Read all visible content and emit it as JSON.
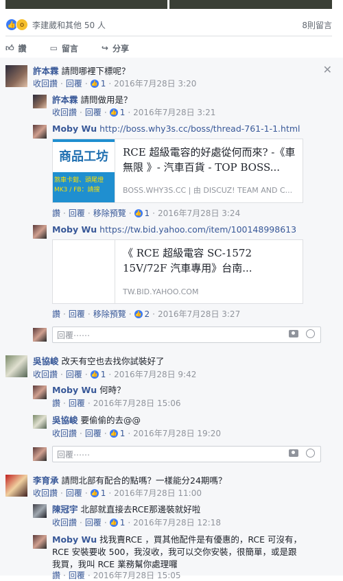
{
  "post": {
    "reactions_text": "李建葳和其他 50 人",
    "comment_count": "8則留言",
    "actions": {
      "like": "讚",
      "comment": "留言",
      "share": "分享"
    }
  },
  "actions": {
    "unlike": "收回讚",
    "like": "讚",
    "reply": "回覆",
    "remove_preview": "移除預覽",
    "reply_placeholder": "回覆⋯⋯"
  },
  "comments": [
    {
      "author": "許本霖",
      "text": "請問哪裡下標呢？",
      "likes": "1",
      "time": "2016年7月28日 3:20",
      "replies": [
        {
          "author": "許本霖",
          "text": "請問做用是？",
          "likes": "1",
          "time": "2016年7月28日 3:21"
        },
        {
          "author": "Moby Wu",
          "link": "http://boss.why3s.cc/boss/thread-761-1-1.html",
          "preview": {
            "title": "RCE 超級電容的好處從何而來? -《車無限 》- 汽車百貨 - TOP BOSS...",
            "domain": "BOSS.WHY3S.CC | 由 DISCUZ! TEAM AND C...",
            "thumb_text1": "商品工坊",
            "thumb_text2": "煞車卡鉗、頭尾燈",
            "thumb_text3": "MK3 / FB：請搜"
          },
          "likes": "1",
          "time": "2016年7月28日 3:24"
        },
        {
          "author": "Moby Wu",
          "link": "https://tw.bid.yahoo.com/item/100148998613",
          "preview": {
            "title": "《 RCE 超級電容 SC-1572 15V/72F 汽車專用》台南...",
            "domain": "TW.BID.YAHOO.COM"
          },
          "likes": "2",
          "time": "2016年7月28日 3:27"
        }
      ]
    },
    {
      "author": "吳協峻",
      "text": "改天有空也去找你試裝好了",
      "likes": "1",
      "time": "2016年7月28日 9:42",
      "replies": [
        {
          "author": "Moby Wu",
          "text": "何時？",
          "time": "2016年7月28日 15:06"
        },
        {
          "author": "吳協峻",
          "text": "要偷偷的去@@",
          "likes": "1",
          "time": "2016年7月28日 19:20"
        }
      ]
    },
    {
      "author": "李育承",
      "text": "請問北部有配合的點嗎？一樣能分24期嗎？",
      "likes": "1",
      "time": "2016年7月28日 11:00",
      "replies": [
        {
          "author": "陳冠宇",
          "text": "北部就直接去RCE那邊裝就好啦",
          "likes": "1",
          "time": "2016年7月28日 12:18"
        },
        {
          "author": "Moby Wu",
          "text_lines": [
            "找我賣RCE ，買其他配件是有優惠的，RCE 可沒有，",
            "RCE 安裝要收 500，我沒收，我可以交你安裝，很簡單，或是跟",
            "我買，我叫 RCE 業務幫你處理囉"
          ],
          "time": "2016年7月28日 15:05"
        }
      ]
    }
  ],
  "icons": {
    "close": "close-icon",
    "camera": "camera-icon",
    "emoji": "emoji-icon",
    "like": "like-icon",
    "wow": "wow-icon"
  }
}
